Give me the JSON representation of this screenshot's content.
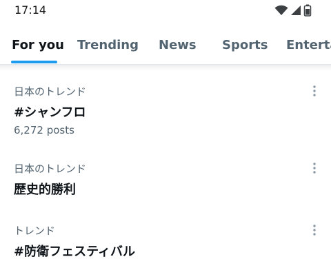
{
  "status_bar": {
    "time": "17:14",
    "icons": [
      "wifi-icon",
      "signal-icon",
      "battery-icon"
    ]
  },
  "tabs": [
    {
      "label": "For you",
      "active": true
    },
    {
      "label": "Trending",
      "active": false
    },
    {
      "label": "News",
      "active": false
    },
    {
      "label": "Sports",
      "active": false
    },
    {
      "label": "Enterta",
      "active": false
    }
  ],
  "trends": [
    {
      "context": "日本のトレンド",
      "name": "#シャンフロ",
      "count": "6,272 posts"
    },
    {
      "context": "日本のトレンド",
      "name": "歴史的勝利"
    },
    {
      "context": "トレンド",
      "name": "#防衛フェスティバル"
    }
  ],
  "colors": {
    "accent": "#1d9bf0",
    "text_primary": "#0f1419",
    "text_secondary": "#536471"
  }
}
